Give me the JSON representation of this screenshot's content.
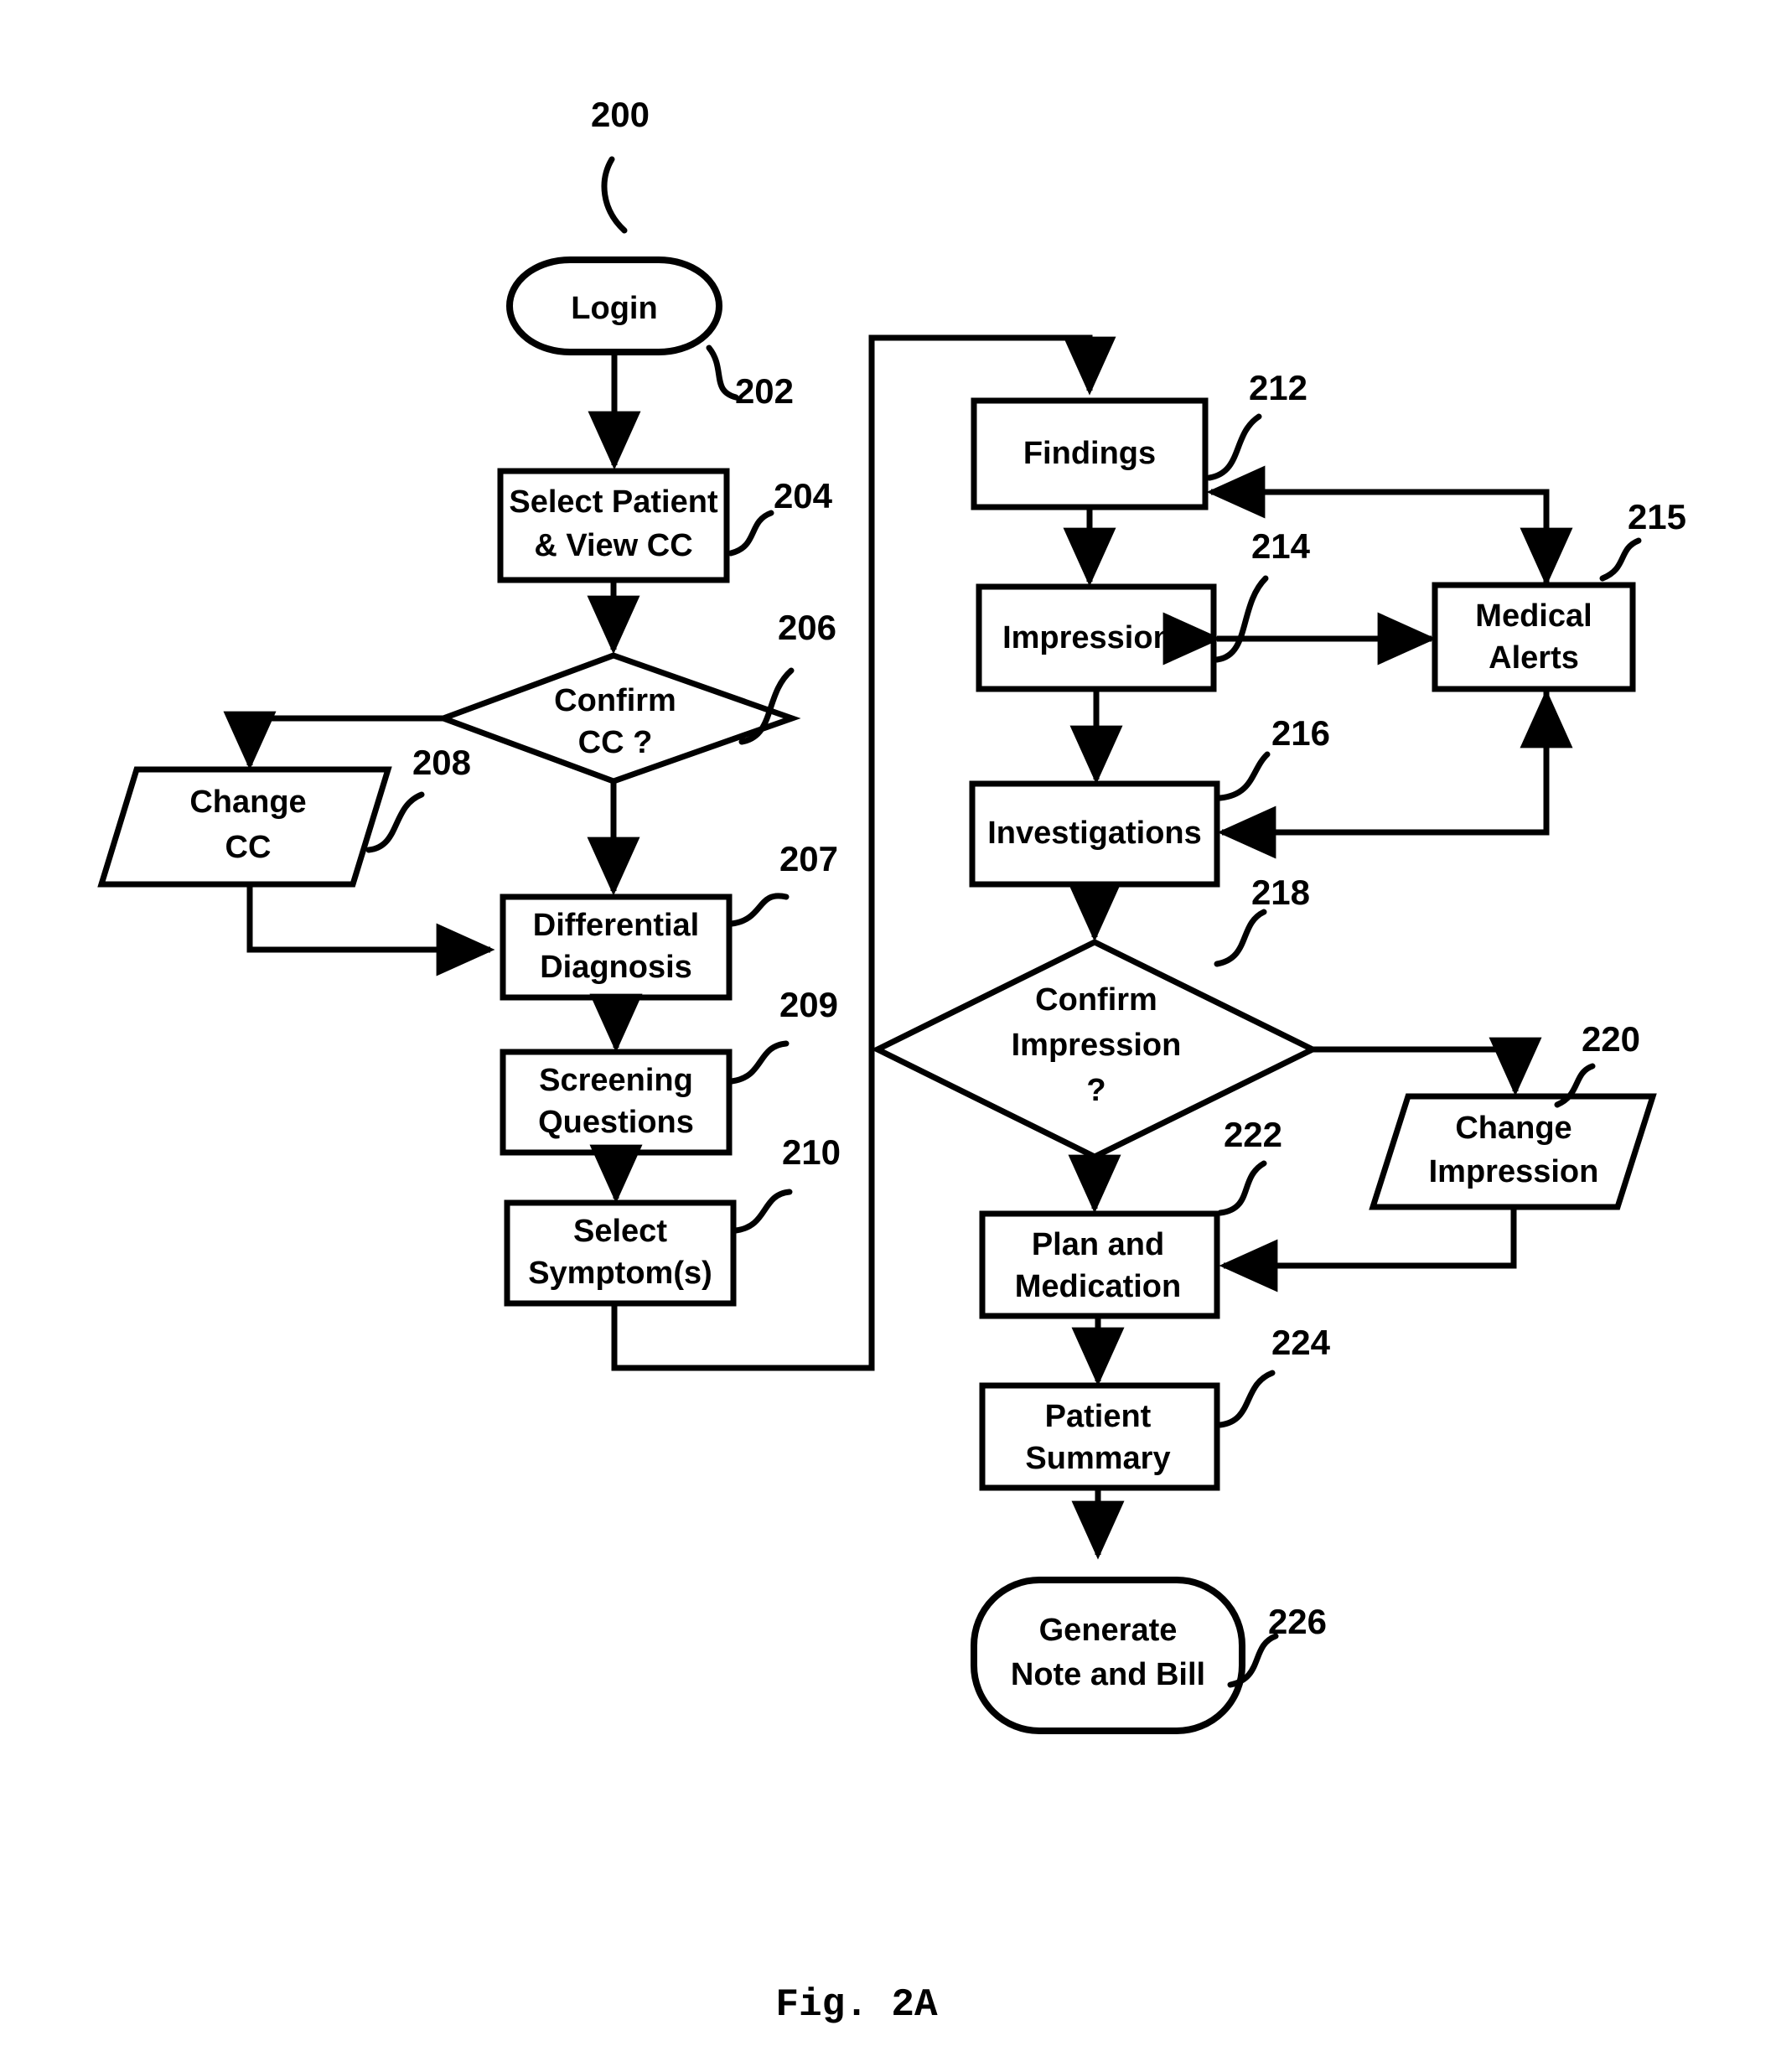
{
  "figure": {
    "caption": "Fig. 2A",
    "diagram_ref": "200"
  },
  "nodes": {
    "login": {
      "label": "Login",
      "ref": "202",
      "shape": "terminator"
    },
    "select_patient": {
      "line1": "Select Patient",
      "line2": "& View CC",
      "ref": "204",
      "shape": "process"
    },
    "confirm_cc": {
      "line1": "Confirm",
      "line2": "CC ?",
      "ref": "206",
      "shape": "decision"
    },
    "change_cc": {
      "line1": "Change",
      "line2": "CC",
      "ref": "208",
      "shape": "io-parallelogram"
    },
    "differential_diagnosis": {
      "line1": "Differential",
      "line2": "Diagnosis",
      "ref": "207",
      "shape": "process"
    },
    "screening_questions": {
      "line1": "Screening",
      "line2": "Questions",
      "ref": "209",
      "shape": "process"
    },
    "select_symptoms": {
      "line1": "Select",
      "line2": "Symptom(s)",
      "ref": "210",
      "shape": "process"
    },
    "findings": {
      "label": "Findings",
      "ref": "212",
      "shape": "process"
    },
    "impressions": {
      "label": "Impressions",
      "ref": "214",
      "shape": "process"
    },
    "medical_alerts": {
      "line1": "Medical",
      "line2": "Alerts",
      "ref": "215",
      "shape": "process"
    },
    "investigations": {
      "label": "Investigations",
      "ref": "216",
      "shape": "process"
    },
    "confirm_impression": {
      "line1": "Confirm",
      "line2": "Impression",
      "line3": "?",
      "ref": "218",
      "shape": "decision"
    },
    "change_impression": {
      "line1": "Change",
      "line2": "Impression",
      "ref": "220",
      "shape": "io-parallelogram"
    },
    "plan_medication": {
      "line1": "Plan and",
      "line2": "Medication",
      "ref": "222",
      "shape": "process"
    },
    "patient_summary": {
      "line1": "Patient",
      "line2": "Summary",
      "ref": "224",
      "shape": "process"
    },
    "generate_note_bill": {
      "line1": "Generate",
      "line2": "Note and Bill",
      "ref": "226",
      "shape": "terminator"
    }
  },
  "colors": {
    "stroke": "#000000",
    "fill": "#ffffff",
    "background": "#ffffff"
  }
}
